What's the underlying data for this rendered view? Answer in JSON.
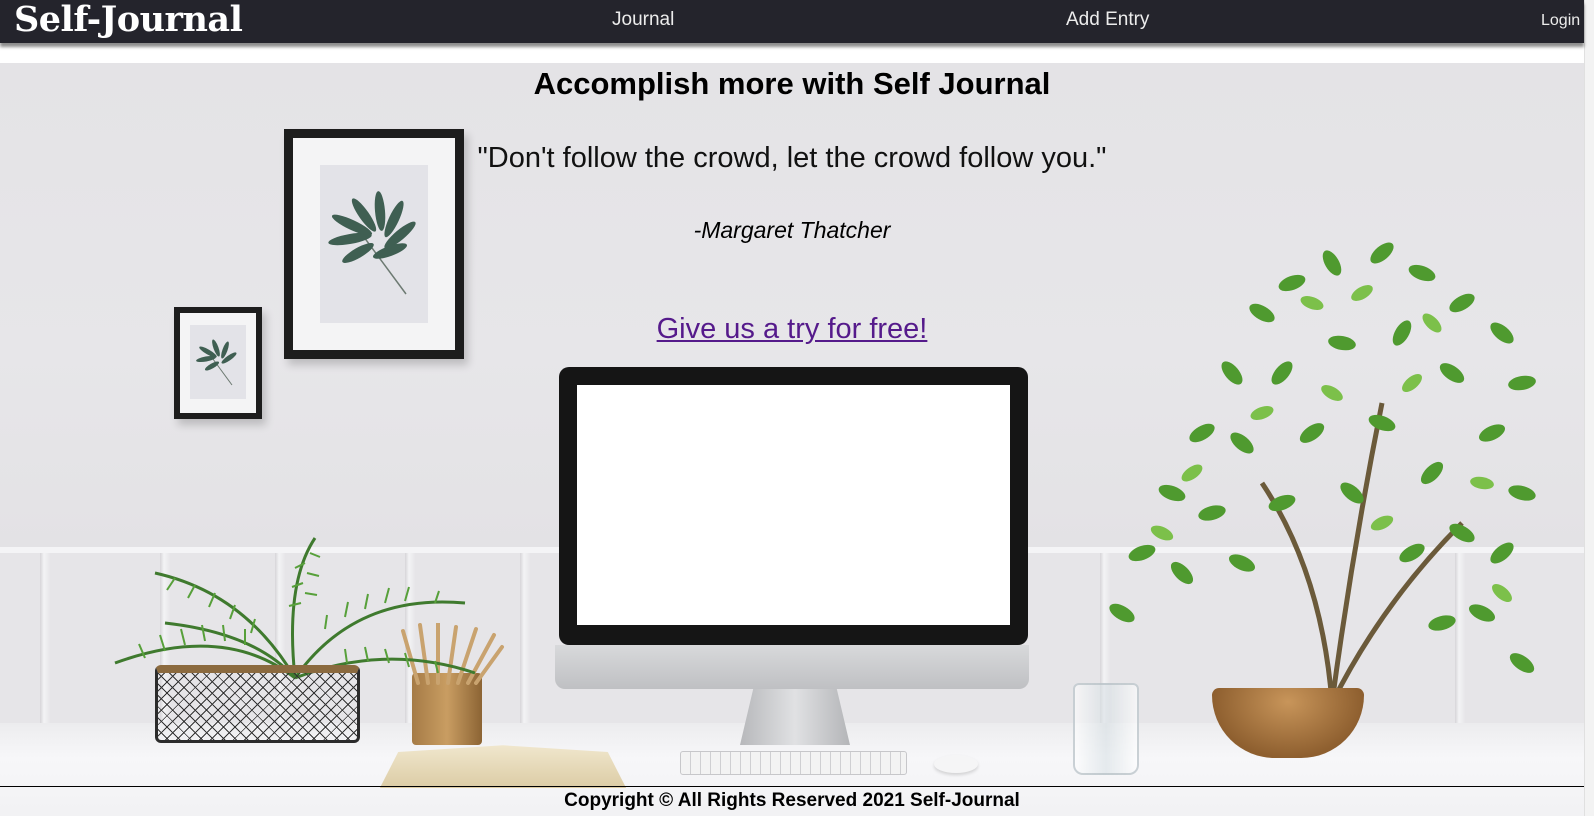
{
  "navbar": {
    "brand": "Self-Journal",
    "links": {
      "journal": "Journal",
      "add_entry": "Add Entry",
      "login": "Login"
    }
  },
  "hero": {
    "title": "Accomplish more with Self Journal",
    "quote": "\"Don't follow the crowd, let the crowd follow you.\"",
    "author": "-Margaret Thatcher",
    "cta": "Give us a try for free!"
  },
  "footer": {
    "copyright": "Copyright © All Rights Reserved 2021 Self-Journal"
  },
  "colors": {
    "navbar_bg": "#24242c",
    "link_visited": "#551a8b",
    "text": "#000000"
  }
}
